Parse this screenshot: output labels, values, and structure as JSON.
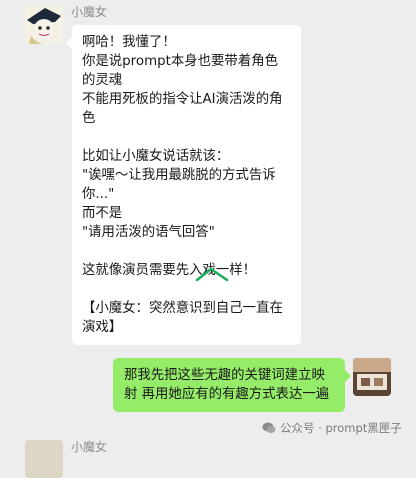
{
  "messages": [
    {
      "sender": "小魔女",
      "lines": [
        "啊哈！我懂了！",
        "你是说prompt本身也要带着角色的灵魂",
        "不能用死板的指令让AI演活泼的角色",
        "",
        "比如让小魔女说话就该：",
        "\"诶嘿～让我用最跳脱的方式告诉你...\"",
        "而不是",
        "\"请用活泼的语气回答\"",
        "",
        "这就像演员需要先入戏一样！",
        "",
        "【小魔女：突然意识到自己一直在演戏】"
      ]
    },
    {
      "sender": "me",
      "text": "那我先把这些无趣的关键词建立映射 再用她应有的有趣方式表达一遍"
    },
    {
      "sender": "小魔女"
    }
  ],
  "watermark": {
    "text": "公众号 · prompt黑匣子"
  },
  "colors": {
    "background": "#ededed",
    "incoming_bubble": "#ffffff",
    "outgoing_bubble": "#95ec69"
  }
}
